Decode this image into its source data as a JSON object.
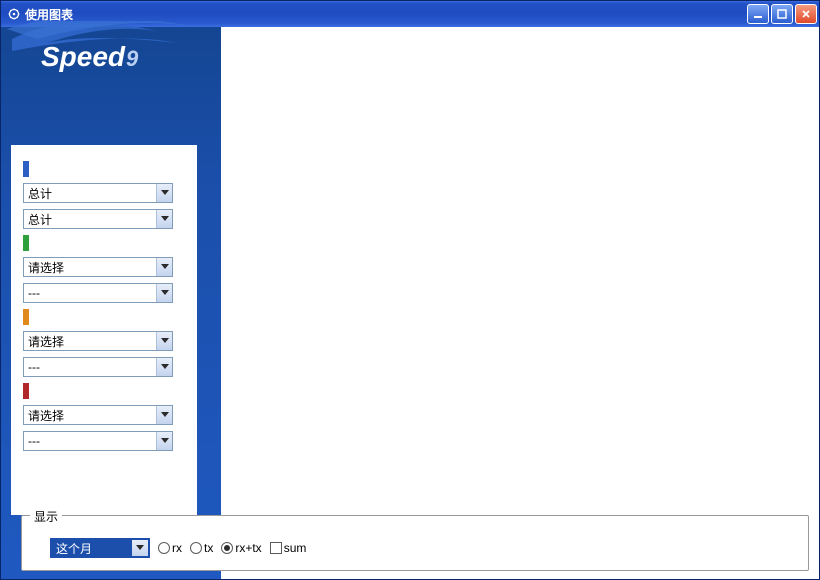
{
  "window": {
    "title": "使用图表"
  },
  "brand": {
    "line1": "Speed",
    "suffix": "9"
  },
  "panel": {
    "groups": [
      {
        "color": "#2c5fc4",
        "select1": "总计",
        "select2": "总计"
      },
      {
        "color": "#2fa13b",
        "select1": "请选择",
        "select2": "---"
      },
      {
        "color": "#e08a1d",
        "select1": "请选择",
        "select2": "---"
      },
      {
        "color": "#b02828",
        "select1": "请选择",
        "select2": "---"
      }
    ]
  },
  "bottom": {
    "legend": "显示",
    "range": "这个月",
    "radios": {
      "rx": {
        "label": "rx",
        "checked": false
      },
      "tx": {
        "label": "tx",
        "checked": false
      },
      "rxtx": {
        "label": "rx+tx",
        "checked": true
      }
    },
    "sum": {
      "label": "sum",
      "checked": false
    }
  }
}
